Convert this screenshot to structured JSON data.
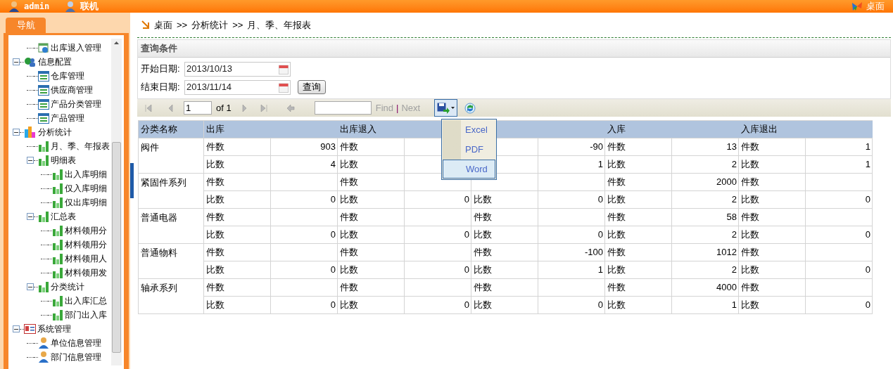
{
  "top_bar": {
    "user": "admin",
    "status": "联机",
    "desktop_link": "桌面"
  },
  "sidebar": {
    "tab": {
      "label": "导航",
      "selected": true
    },
    "tree_above": [
      {
        "label": "出库退入管理",
        "kind": "globe"
      }
    ],
    "tree": [
      {
        "label": "信息配置",
        "kind": "people",
        "expanded": true,
        "children": [
          {
            "label": "仓库管理",
            "kind": "grid"
          },
          {
            "label": "供应商管理",
            "kind": "grid"
          },
          {
            "label": "产品分类管理",
            "kind": "grid"
          },
          {
            "label": "产品管理",
            "kind": "grid"
          }
        ]
      },
      {
        "label": "分析统计",
        "kind": "chart",
        "expanded": true,
        "children": [
          {
            "label": "月、季、年报表",
            "kind": "bars"
          },
          {
            "label": "明细表",
            "kind": "bars",
            "expanded": true,
            "children": [
              {
                "label": "出入库明细",
                "kind": "bars"
              },
              {
                "label": "仅入库明细",
                "kind": "bars"
              },
              {
                "label": "仅出库明细",
                "kind": "bars"
              }
            ]
          },
          {
            "label": "汇总表",
            "kind": "bars",
            "expanded": true,
            "children": [
              {
                "label": "材料领用分",
                "kind": "bars"
              },
              {
                "label": "材料领用分",
                "kind": "bars"
              },
              {
                "label": "材料领用人",
                "kind": "bars"
              },
              {
                "label": "材料领用发",
                "kind": "bars"
              }
            ]
          },
          {
            "label": "分类统计",
            "kind": "bars",
            "expanded": true,
            "children": [
              {
                "label": "出入库汇总",
                "kind": "bars"
              },
              {
                "label": "部门出入库",
                "kind": "bars"
              }
            ]
          }
        ]
      },
      {
        "label": "系统管理",
        "kind": "card",
        "expanded": true,
        "children": [
          {
            "label": "单位信息管理",
            "kind": "user"
          },
          {
            "label": "部门信息管理",
            "kind": "user"
          }
        ]
      }
    ]
  },
  "breadcrumb": [
    "桌面",
    ">>",
    "分析统计",
    ">>",
    "月、季、年报表"
  ],
  "query_panel": {
    "title": "查询条件",
    "fields": [
      {
        "label": "开始日期:",
        "value": "2013/10/13"
      },
      {
        "label": "结束日期:",
        "value": "2013/11/14"
      }
    ],
    "button": "查询"
  },
  "toolbar": {
    "page": "1",
    "of": "of 1",
    "find_label": "Find",
    "separator": "|",
    "next_label": "Next",
    "find_disabled": true,
    "export_open": true,
    "export_menu": [
      {
        "label": "Excel",
        "selected": false
      },
      {
        "label": "PDF",
        "selected": false
      },
      {
        "label": "Word",
        "selected": true
      }
    ]
  },
  "table": {
    "first_column": "分类名称",
    "groups": [
      {
        "kind": "named",
        "name": "出库"
      },
      {
        "kind": "named",
        "name": "出库退入"
      },
      {
        "kind": "covered"
      },
      {
        "kind": "named",
        "name": "入库"
      },
      {
        "kind": "named",
        "name": "入库退出"
      }
    ],
    "rows": [
      {
        "category": "阀件",
        "lines": [
          [
            {
              "label": "件数",
              "value": "903"
            },
            {
              "label": "件数"
            },
            {
              "value": "-90"
            },
            {
              "label": "件数",
              "value": "13"
            },
            {
              "label": "件数",
              "value": "1"
            }
          ],
          [
            {
              "label": "比数",
              "value": "4"
            },
            {
              "label": "比数"
            },
            {
              "value": "1"
            },
            {
              "label": "比数",
              "value": "2"
            },
            {
              "label": "比数",
              "value": "1"
            }
          ]
        ]
      },
      {
        "category": "紧固件系列",
        "lines": [
          [
            {
              "label": "件数"
            },
            {
              "label": "件数"
            },
            {
              "covered": true
            },
            {
              "label": "件数",
              "value": "2000"
            },
            {
              "label": "件数"
            }
          ],
          [
            {
              "label": "比数",
              "value": "0"
            },
            {
              "label": "比数",
              "value": "0"
            },
            {
              "label": "比数",
              "value": "0"
            },
            {
              "label": "比数",
              "value": "2"
            },
            {
              "label": "比数",
              "value": "0"
            }
          ]
        ]
      },
      {
        "category": "普通电器",
        "lines": [
          [
            {
              "label": "件数"
            },
            {
              "label": "件数"
            },
            {
              "label": "件数"
            },
            {
              "label": "件数",
              "value": "58"
            },
            {
              "label": "件数"
            }
          ],
          [
            {
              "label": "比数",
              "value": "0"
            },
            {
              "label": "比数",
              "value": "0"
            },
            {
              "label": "比数",
              "value": "0"
            },
            {
              "label": "比数",
              "value": "2"
            },
            {
              "label": "比数",
              "value": "0"
            }
          ]
        ]
      },
      {
        "category": "普通物料",
        "lines": [
          [
            {
              "label": "件数"
            },
            {
              "label": "件数"
            },
            {
              "label": "件数",
              "value": "-100"
            },
            {
              "label": "件数",
              "value": "1012"
            },
            {
              "label": "件数"
            }
          ],
          [
            {
              "label": "比数",
              "value": "0"
            },
            {
              "label": "比数",
              "value": "0"
            },
            {
              "label": "比数",
              "value": "1"
            },
            {
              "label": "比数",
              "value": "2"
            },
            {
              "label": "比数",
              "value": "0"
            }
          ]
        ]
      },
      {
        "category": "轴承系列",
        "lines": [
          [
            {
              "label": "件数"
            },
            {
              "label": "件数"
            },
            {
              "label": "件数"
            },
            {
              "label": "件数",
              "value": "4000"
            },
            {
              "label": "件数"
            }
          ],
          [
            {
              "label": "比数",
              "value": "0"
            },
            {
              "label": "比数",
              "value": "0"
            },
            {
              "label": "比数",
              "value": "0"
            },
            {
              "label": "比数",
              "value": "1"
            },
            {
              "label": "比数",
              "value": "0"
            }
          ]
        ]
      }
    ]
  }
}
